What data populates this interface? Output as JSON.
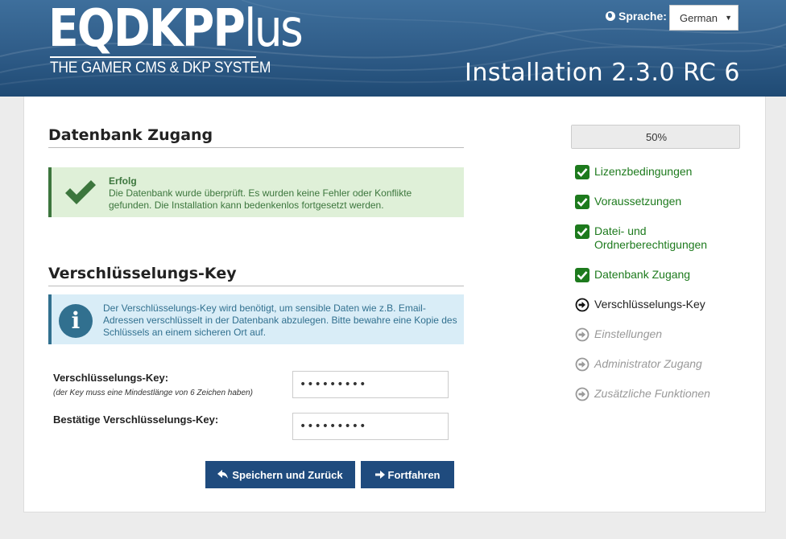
{
  "header": {
    "logo_main": "EQDKP",
    "logo_light": "lus",
    "logo_plus_letter": "P",
    "tagline": "THE GAMER CMS & DKP SYSTEM",
    "language_label": "Sprache:",
    "language_value": "German",
    "version": "Installation 2.3.0 RC 6"
  },
  "database": {
    "heading": "Datenbank Zugang",
    "success_title": "Erfolg",
    "success_message": "Die Datenbank wurde überprüft. Es wurden keine Fehler oder Konflikte gefunden. Die Installation kann bedenkenlos fortgesetzt werden."
  },
  "encryption": {
    "heading": "Verschlüsselungs-Key",
    "info_message": "Der Verschlüsselungs-Key wird benötigt, um sensible Daten wie z.B. Email-Adressen verschlüsselt in der Datenbank abzulegen. Bitte bewahre eine Kopie des Schlüssels an einem sicheren Ort auf.",
    "key_label": "Verschlüsselungs-Key:",
    "key_hint": "(der Key muss eine Mindestlänge von 6 Zeichen haben)",
    "key_value": "•••••••••",
    "confirm_label": "Bestätige Verschlüsselungs-Key:",
    "confirm_value": "•••••••••"
  },
  "buttons": {
    "save_back": "Speichern und Zurück",
    "continue": "Fortfahren"
  },
  "progress": {
    "value": 0.5,
    "label": "50%"
  },
  "steps": [
    {
      "label": "Lizenzbedingungen",
      "status": "done"
    },
    {
      "label": "Voraussetzungen",
      "status": "done"
    },
    {
      "label": "Datei- und Ordnerberechtigungen",
      "status": "done"
    },
    {
      "label": "Datenbank Zugang",
      "status": "done"
    },
    {
      "label": "Verschlüsselungs-Key",
      "status": "active"
    },
    {
      "label": "Einstellungen",
      "status": "todo"
    },
    {
      "label": "Administrator Zugang",
      "status": "todo"
    },
    {
      "label": "Zusätzliche Funktionen",
      "status": "todo"
    }
  ],
  "colors": {
    "header": "#2f5c88",
    "success": "#3c763d",
    "info": "#31708f",
    "button": "#1f4b7e",
    "step_done": "#1d7a1d",
    "step_todo": "#999999"
  }
}
